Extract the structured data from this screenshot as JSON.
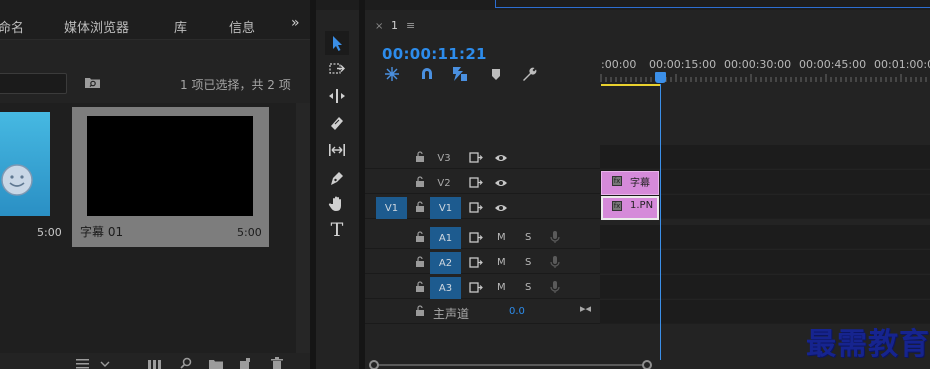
{
  "project_panel": {
    "tabs": [
      "命名",
      "媒体浏览器",
      "库",
      "信息"
    ],
    "more_label": "»",
    "search_value": "",
    "selection_status": "1 项已选择，共 2 项",
    "clips": [
      {
        "name": "",
        "duration": "5:00",
        "thumb": "smiley-image"
      },
      {
        "name": "字幕 01",
        "duration": "5:00",
        "thumb": "black-frame"
      }
    ],
    "footer_icons": [
      "list-view-icon",
      "sort-icon",
      "storyboard-icon",
      "find-icon",
      "new-bin-icon",
      "new-item-icon",
      "trash-icon"
    ]
  },
  "tools": [
    "selection-tool",
    "track-select-tool",
    "ripple-edit-tool",
    "razor-tool",
    "slip-tool",
    "pen-tool",
    "hand-tool",
    "type-tool"
  ],
  "timeline": {
    "close_label": "×",
    "sequence_name": "1",
    "menu_label": "≡",
    "timecode": "00:00:11:21",
    "ruler_labels": [
      ":00:00",
      "00:00:15:00",
      "00:00:30:00",
      "00:00:45:00",
      "00:01:00:00"
    ],
    "video_tracks": [
      {
        "source": "",
        "name": "V3",
        "sync": "sync-lock-icon",
        "eye": "eye-icon"
      },
      {
        "source": "",
        "name": "V2",
        "sync": "sync-lock-icon",
        "eye": "eye-icon"
      },
      {
        "source": "V1",
        "name": "V1",
        "sync": "sync-lock-icon",
        "eye": "eye-icon"
      }
    ],
    "audio_tracks": [
      {
        "name": "A1",
        "m": "M",
        "s": "S"
      },
      {
        "name": "A2",
        "m": "M",
        "s": "S"
      },
      {
        "name": "A3",
        "m": "M",
        "s": "S"
      }
    ],
    "master": {
      "label": "主声道",
      "value": "0.0",
      "end_icon": "▸◂"
    },
    "clips": [
      {
        "track": "V2",
        "label": "字幕",
        "fx": "fx"
      },
      {
        "track": "V1",
        "label": "1.PN",
        "fx": "fx"
      }
    ],
    "playhead_seconds": 11.875
  },
  "watermark": "最需教育",
  "colors": {
    "accent": "#2d8ceb",
    "track_target": "#1d5b8f",
    "clip": "#d58ad9",
    "in_out": "#e9d12e",
    "watermark": "#16248f"
  }
}
